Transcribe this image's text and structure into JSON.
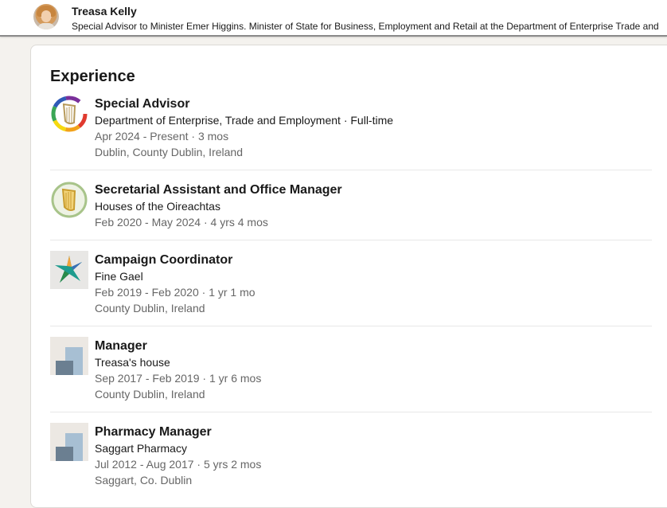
{
  "header": {
    "name": "Treasa Kelly",
    "headline": "Special Advisor to Minister Emer Higgins. Minister of State for Business, Employment and Retail at the Department of Enterprise Trade and ..."
  },
  "experience": {
    "section_title": "Experience",
    "entries": [
      {
        "title": "Special Advisor",
        "company": "Department of Enterprise, Trade and Employment · Full-time",
        "dates": "Apr 2024 - Present · 3 mos",
        "location": "Dublin, County Dublin, Ireland",
        "logo": "harp-rainbow-logo"
      },
      {
        "title": "Secretarial Assistant and Office Manager",
        "company": "Houses of the Oireachtas",
        "dates": "Feb 2020 - May 2024 · 4 yrs 4 mos",
        "logo": "harp-green-logo"
      },
      {
        "title": "Campaign Coordinator",
        "company": "Fine Gael",
        "dates": "Feb 2019 - Feb 2020 · 1 yr 1 mo",
        "location": "County Dublin, Ireland",
        "logo": "star-logo"
      },
      {
        "title": "Manager",
        "company": "Treasa's house",
        "dates": "Sep 2017 - Feb 2019 · 1 yr 6 mos",
        "location": "County Dublin, Ireland",
        "logo": "company-placeholder-logo"
      },
      {
        "title": "Pharmacy Manager",
        "company": "Saggart Pharmacy",
        "dates": "Jul 2012 - Aug 2017 · 5 yrs 2 mos",
        "location": "Saggart, Co. Dublin",
        "logo": "company-placeholder-logo"
      }
    ]
  }
}
